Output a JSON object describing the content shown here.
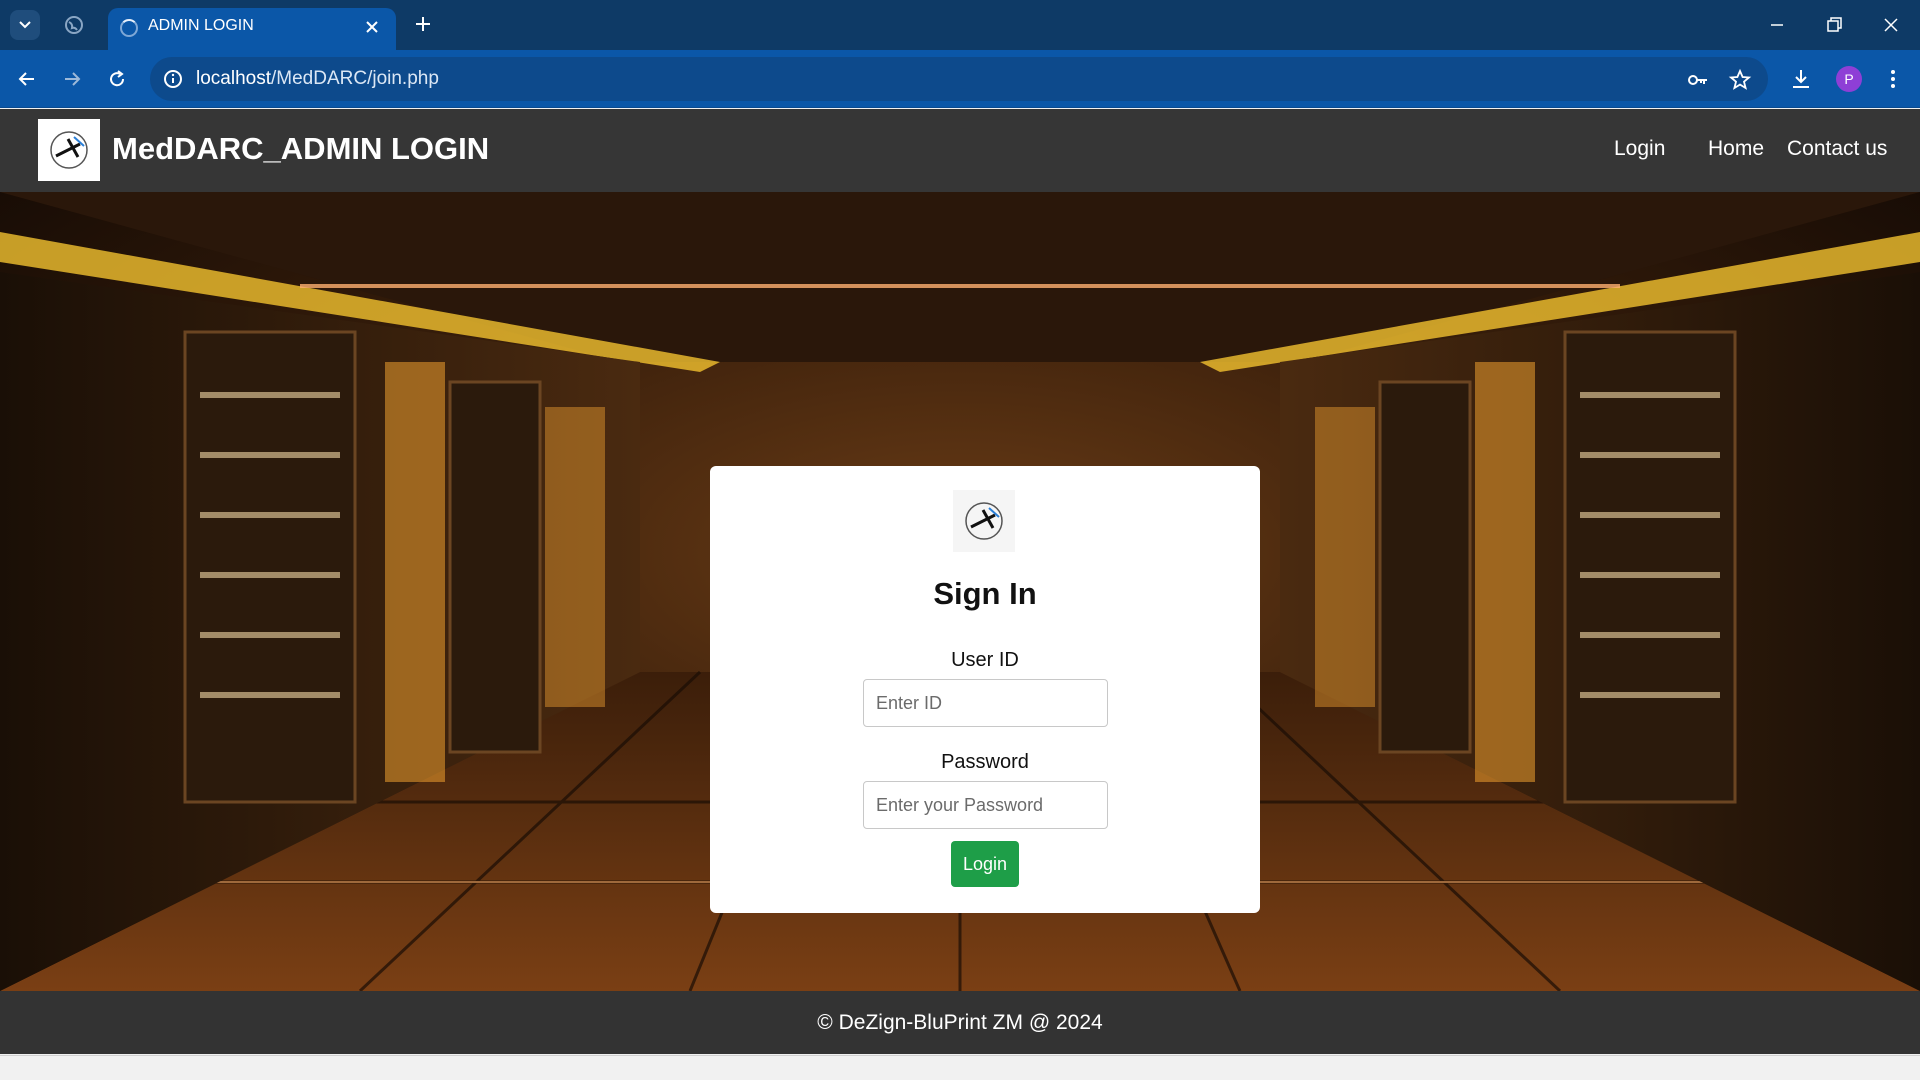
{
  "browser": {
    "tab_title": "ADMIN LOGIN",
    "url_host": "localhost",
    "url_path": "/MedDARC/join.php",
    "profile_initial": "P"
  },
  "header": {
    "title": "MedDARC_ADMIN LOGIN",
    "nav": [
      "Login",
      "Home",
      "Contact us"
    ]
  },
  "login_card": {
    "title": "Sign In",
    "user_id_label": "User ID",
    "user_id_placeholder": "Enter ID",
    "password_label": "Password",
    "password_placeholder": "Enter your Password",
    "button_label": "Login"
  },
  "footer": {
    "text": "© DeZign-BluPrint ZM @ 2024"
  },
  "colors": {
    "tabstrip": "#0e3a66",
    "toolbar": "#0b57a8",
    "header_bg": "#363636",
    "footer_bg": "#333333",
    "login_button": "#1e9e48"
  }
}
